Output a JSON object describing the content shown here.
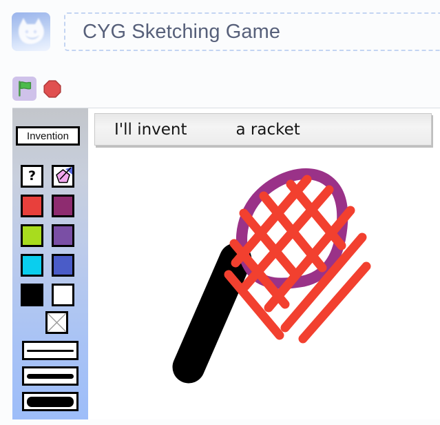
{
  "header": {
    "avatar_icon": "scratch-cat-avatar",
    "project_title": "CYG Sketching Game"
  },
  "controls": {
    "green_flag_icon": "green-flag-icon",
    "stop_icon": "stop-sign-icon",
    "fullscreen_icon": "fullscreen-expand-icon"
  },
  "stage": {
    "speech": {
      "line_1": "I'll invent",
      "line_2": "a racket"
    },
    "sidebar": {
      "mode_label": "Invention",
      "tools": [
        {
          "name": "help-icon",
          "label": "?"
        },
        {
          "name": "fill-tool-icon",
          "label": ""
        }
      ],
      "colors": [
        {
          "name": "color-red",
          "hex": "#e8403c"
        },
        {
          "name": "color-magenta",
          "hex": "#8e2c70"
        },
        {
          "name": "color-lime",
          "hex": "#a8dc1e"
        },
        {
          "name": "color-purple",
          "hex": "#7a4fa5"
        },
        {
          "name": "color-cyan",
          "hex": "#0aceee"
        },
        {
          "name": "color-blue",
          "hex": "#4a5cc8"
        },
        {
          "name": "color-black",
          "hex": "#000000"
        },
        {
          "name": "color-white",
          "hex": "#ffffff"
        }
      ],
      "clear_icon": "clear-x-icon",
      "brush_sizes": [
        {
          "name": "brush-thin",
          "thickness": 3
        },
        {
          "name": "brush-medium",
          "thickness": 7
        },
        {
          "name": "brush-thick",
          "thickness": 15
        }
      ]
    },
    "drawing": {
      "name": "racket-sketch",
      "head_color": "#9a3288",
      "string_color": "#f2402f",
      "handle_color": "#000000"
    }
  }
}
